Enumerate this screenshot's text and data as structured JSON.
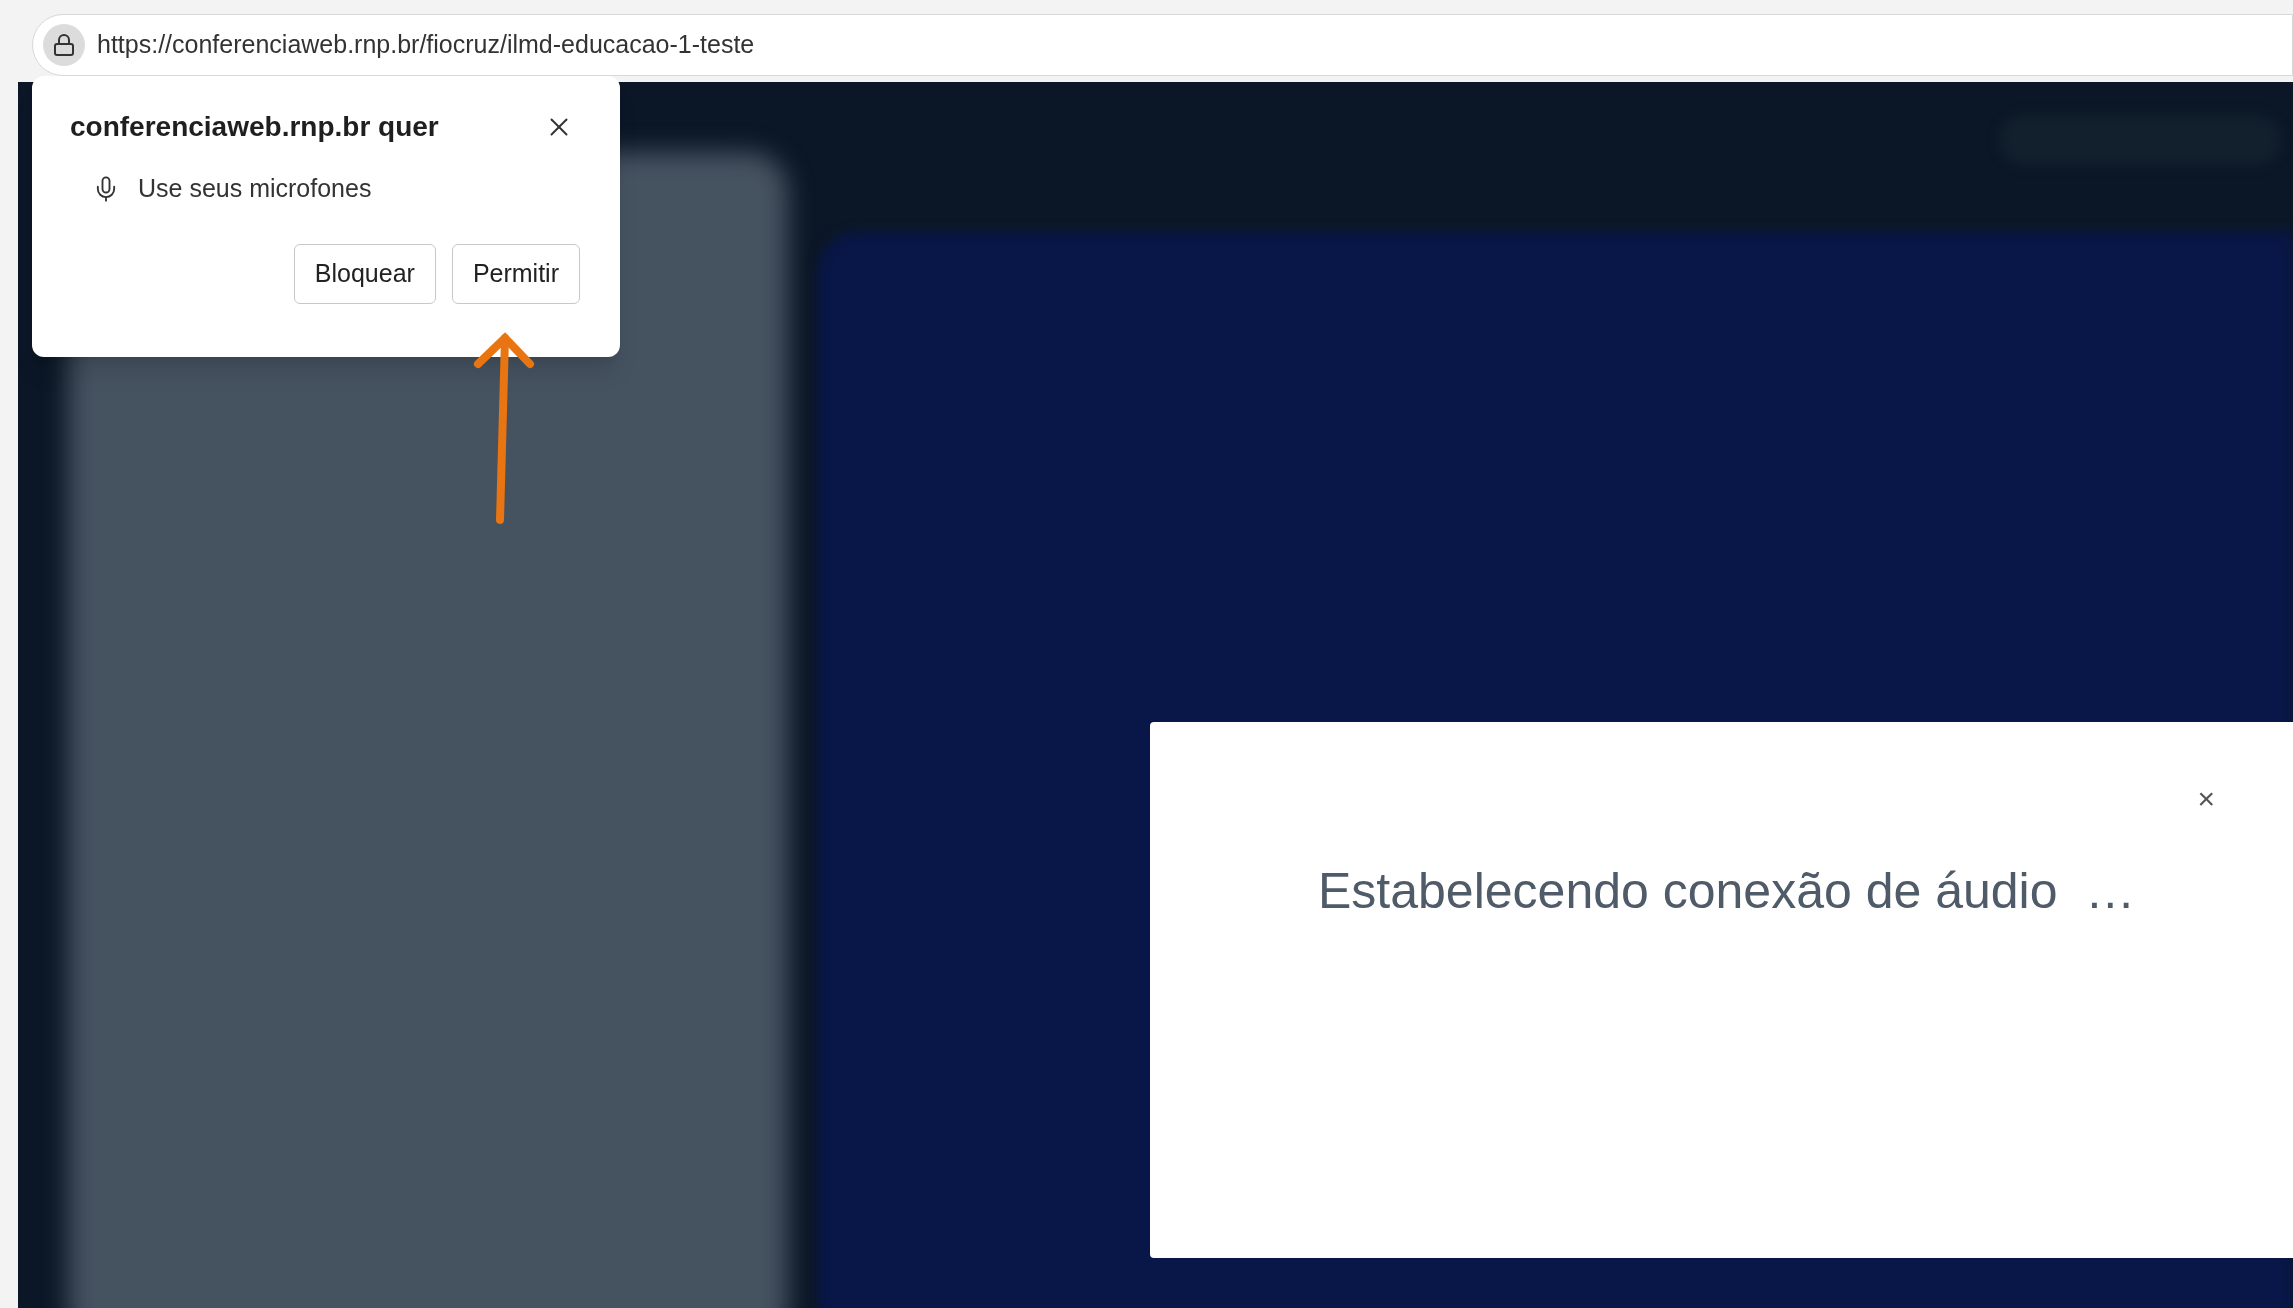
{
  "address_bar": {
    "url": "https://conferenciaweb.rnp.br/fiocruz/ilmd-educacao-1-teste"
  },
  "permission_popup": {
    "title": "conferenciaweb.rnp.br quer",
    "permission": "Use seus microfones",
    "buttons": [
      {
        "label": "Bloquear"
      },
      {
        "label": "Permitir"
      }
    ]
  },
  "dialog": {
    "close": "×",
    "message": "Estabelecendo conexão de áudio  …"
  }
}
